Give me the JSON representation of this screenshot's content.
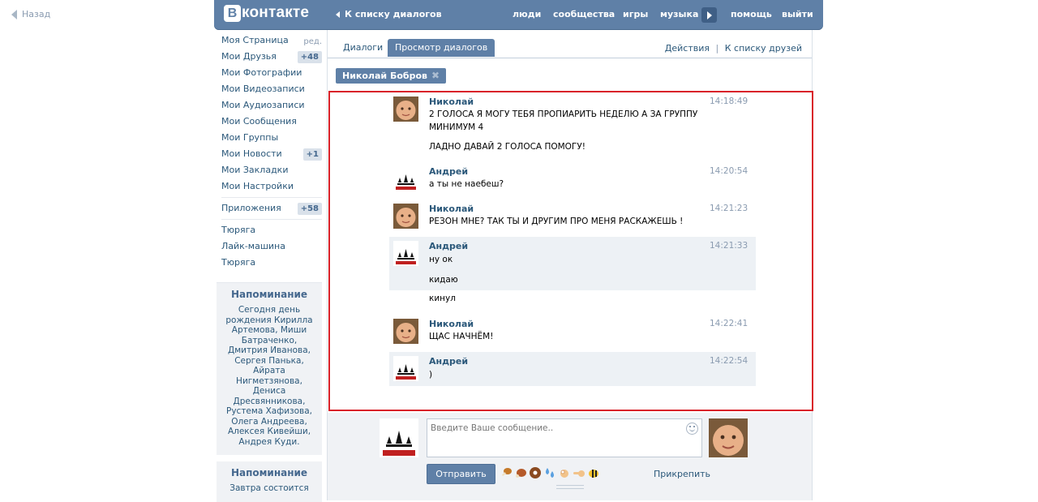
{
  "top": {
    "back_label": "Назад"
  },
  "header": {
    "logo_letter": "В",
    "logo_text": "контакте",
    "back_to_dialogs": "К списку диалогов",
    "nav": [
      "люди",
      "сообщества",
      "игры",
      "музыка",
      "помощь",
      "выйти"
    ]
  },
  "sidebar": {
    "items": [
      {
        "label": "Моя Страница",
        "extra": "ред."
      },
      {
        "label": "Мои Друзья",
        "badge": "+48"
      },
      {
        "label": "Мои Фотографии"
      },
      {
        "label": "Мои Видеозаписи"
      },
      {
        "label": "Мои Аудиозаписи"
      },
      {
        "label": "Мои Сообщения"
      },
      {
        "label": "Мои Группы"
      },
      {
        "label": "Мои Новости",
        "badge": "+1"
      },
      {
        "label": "Мои Закладки"
      },
      {
        "label": "Мои Настройки"
      }
    ],
    "apps": {
      "label": "Приложения",
      "badge": "+58"
    },
    "links": [
      "Тюряга",
      "Лайк-машина",
      "Тюряга"
    ],
    "reminder1": {
      "title": "Напоминание",
      "text": "Сегодня день рождения Кирилла Артемова, Миши Батраченко, Дмитрия Иванова, Сергея Панька, Айрата Нигметзянова, Дениса Дресвянникова, Рустема Хафизова, Олега Андреева, Алексея Кивейши, Андрея Куди."
    },
    "reminder2": {
      "title": "Напоминание",
      "text": "Завтра состоится"
    }
  },
  "tabs": {
    "dialogs": "Диалоги",
    "view": "Просмотр диалогов",
    "actions": "Действия",
    "separator": "|",
    "friends": "К списку друзей"
  },
  "chip": {
    "name": "Николай Бобров",
    "close": "✖"
  },
  "messages": [
    {
      "author": "Николай",
      "time": "14:18:49",
      "lines": [
        "2 ГОЛОСА Я МОГУ ТЕБЯ ПРОПИАРИТЬ НЕДЕЛЮ А ЗА ГРУППУ",
        "МИНИМУМ 4",
        "ЛАДНО ДАВАЙ 2 ГОЛОСА ПОМОГУ!"
      ]
    },
    {
      "author": "Андрей",
      "time": "14:20:54",
      "lines": [
        "а ты не наебеш?"
      ]
    },
    {
      "author": "Николай",
      "time": "14:21:23",
      "lines": [
        "РЕЗОН МНЕ? ТАК ТЫ И ДРУГИМ ПРО МЕНЯ РАСКАЖЕШЬ !"
      ]
    },
    {
      "author": "Андрей",
      "time": "14:21:33",
      "lines": [
        "ну ок",
        "кидаю",
        "кинул"
      ]
    },
    {
      "author": "Николай",
      "time": "14:22:41",
      "lines": [
        "ЩАС НАЧНЁМ!"
      ]
    },
    {
      "author": "Андрей",
      "time": "14:22:54",
      "lines": [
        ")"
      ]
    }
  ],
  "composer": {
    "placeholder": "Введите Ваше сообщение..",
    "send": "Отправить",
    "attach": "Прикрепить",
    "emoji_icons": [
      "chicken-leg-icon",
      "meat-icon",
      "donut-icon",
      "water-drops-icon",
      "ok-hand-icon",
      "pointing-hand-icon",
      "bee-icon"
    ]
  },
  "colors": {
    "header": "#5f80a7",
    "link": "#2b587a",
    "highlight_box": "#d9232a",
    "message_bg": "#edf1f5"
  }
}
